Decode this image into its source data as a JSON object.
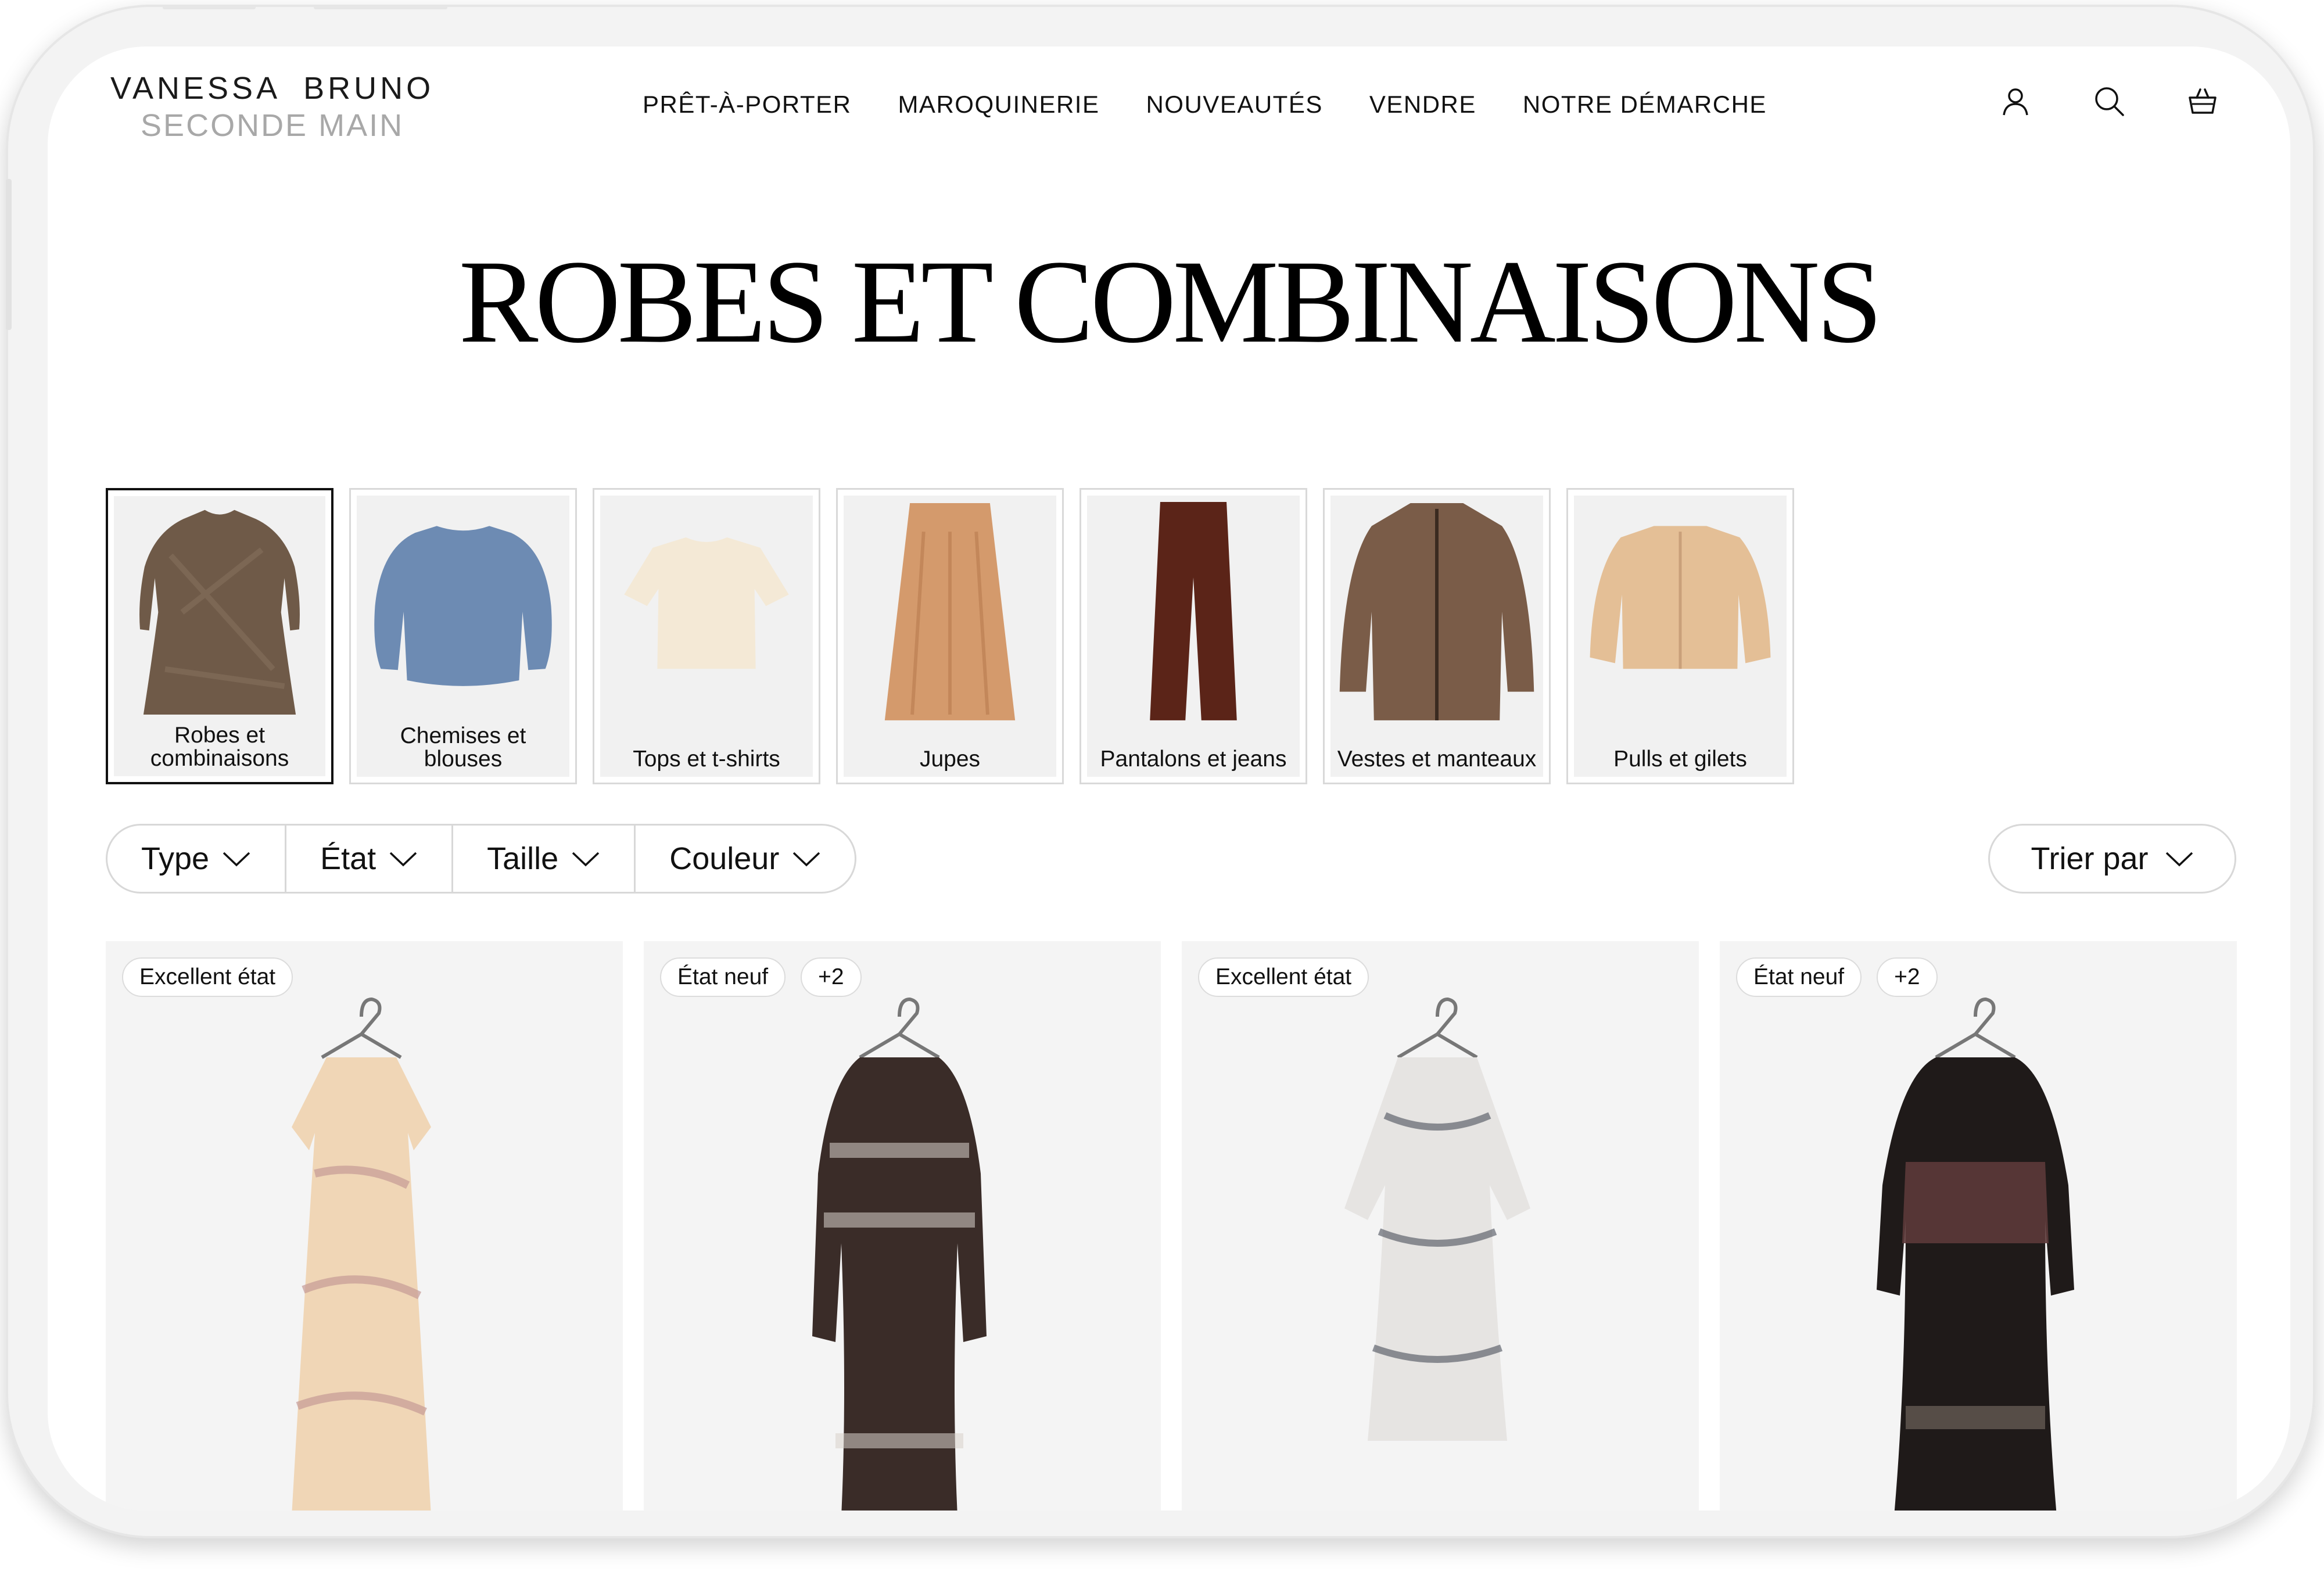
{
  "brand": {
    "line1": "VANESSA  BRUNO",
    "line2": "SECONDE MAIN"
  },
  "nav": [
    "PRÊT-À-PORTER",
    "MAROQUINERIE",
    "NOUVEAUTÉS",
    "VENDRE",
    "NOTRE DÉMARCHE"
  ],
  "icons": [
    "user-icon",
    "search-icon",
    "basket-icon"
  ],
  "page_title": "ROBES ET COMBINAISONS",
  "categories": [
    {
      "label": "Robes et combinaisons",
      "active": true
    },
    {
      "label": "Chemises et blouses"
    },
    {
      "label": "Tops et t-shirts"
    },
    {
      "label": "Jupes"
    },
    {
      "label": "Pantalons et jeans"
    },
    {
      "label": "Vestes et manteaux"
    },
    {
      "label": "Pulls et gilets"
    }
  ],
  "filters": [
    "Type",
    "État",
    "Taille",
    "Couleur"
  ],
  "sort_label": "Trier par",
  "products": [
    {
      "badges": [
        "Excellent état"
      ]
    },
    {
      "badges": [
        "État neuf",
        "+2"
      ]
    },
    {
      "badges": [
        "Excellent état"
      ]
    },
    {
      "badges": [
        "État neuf",
        "+2"
      ]
    }
  ],
  "colors": {
    "frame": "#f3f3f3",
    "tile": "#f4f4f4",
    "border": "#d8d8d8",
    "text": "#111111"
  }
}
